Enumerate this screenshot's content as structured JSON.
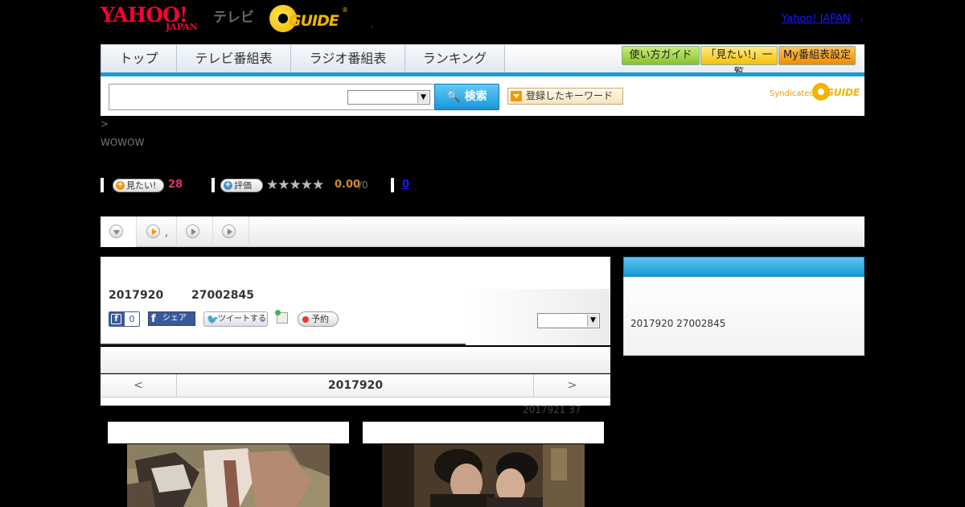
{
  "header": {
    "logo_yahoo": "YAHOO!",
    "logo_japan": "JAPAN",
    "logo_tv": "テレビ",
    "gguide_text": "GUIDE",
    "gguide_reg": "®",
    "dot": ",",
    "yahoo_japan_link": "Yahoo! JAPAN",
    "link_comma": ","
  },
  "nav": {
    "tabs": [
      "トップ",
      "テレビ番組表",
      "ラジオ番組表",
      "ランキング"
    ],
    "buttons": [
      "使い方ガイド",
      "「見たい!」一覧",
      "My番組表設定"
    ]
  },
  "search": {
    "input_value": "",
    "select_value": "",
    "button_label": "検索",
    "keyword_button": "登録したキーワード",
    "syndicated": "Syndicated",
    "syndicated_logo": "GUIDE"
  },
  "breadcrumb": ">",
  "channel": "WOWOW",
  "stats": {
    "want_label": "見たい!",
    "want_count": "28",
    "rate_label": "評価",
    "stars": "★★★★★",
    "rating": "0.00",
    "rating_den": "/0",
    "review_count": "0"
  },
  "tabs_strip": {
    "tab2_text": ","
  },
  "program": {
    "date": "2017920",
    "id": "27002845",
    "fb_like_count": "0",
    "fb_share": "シェア",
    "tweet": "ツイートする",
    "reserve": "予約",
    "select_value": ""
  },
  "date_nav": {
    "prev": "<",
    "current": "2017920",
    "next": ">"
  },
  "update_note": "2017921  37",
  "sidebar": {
    "text": "2017920  27002845"
  },
  "colors": {
    "accent_blue": "#1a9ad6",
    "yahoo_red": "#ff0033",
    "gguide_yellow": "#f0b400",
    "want_pink": "#e0336b"
  }
}
